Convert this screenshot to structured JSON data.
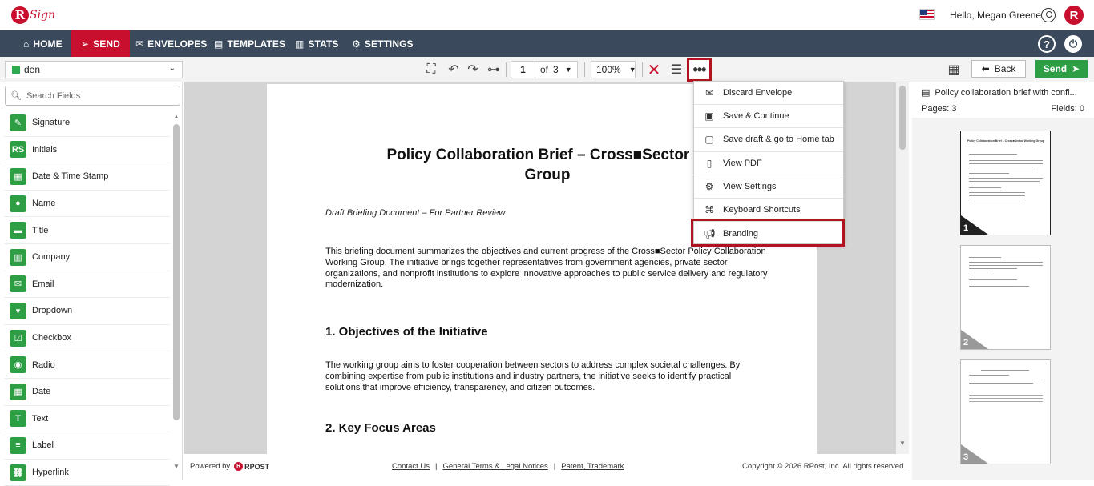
{
  "header": {
    "logo_text": "Sign",
    "greeting": "Hello, Megan Greene",
    "brand_letter": "R"
  },
  "nav": {
    "items": [
      {
        "label": "HOME",
        "icon": "home-icon"
      },
      {
        "label": "SEND",
        "icon": "send-icon"
      },
      {
        "label": "ENVELOPES",
        "icon": "envelope-icon"
      },
      {
        "label": "TEMPLATES",
        "icon": "document-icon"
      },
      {
        "label": "STATS",
        "icon": "bar-chart-icon"
      },
      {
        "label": "SETTINGS",
        "icon": "gear-icon"
      }
    ],
    "active": "SEND",
    "accent": "#c8102e",
    "bg": "#3a4a5c"
  },
  "toolbar": {
    "document": "den",
    "page_current": "1",
    "page_of": "of",
    "page_total": "3",
    "zoom": "100%",
    "back_label": "Back",
    "send_label": "Send"
  },
  "sidebar": {
    "search_placeholder": "Search Fields",
    "fields": [
      {
        "label": "Signature",
        "icon": "pen-icon"
      },
      {
        "label": "Initials",
        "icon": "initials-icon"
      },
      {
        "label": "Date & Time Stamp",
        "icon": "calendar-clock-icon"
      },
      {
        "label": "Name",
        "icon": "person-icon"
      },
      {
        "label": "Title",
        "icon": "briefcase-icon"
      },
      {
        "label": "Company",
        "icon": "building-icon"
      },
      {
        "label": "Email",
        "icon": "mail-icon"
      },
      {
        "label": "Dropdown",
        "icon": "dropdown-icon"
      },
      {
        "label": "Checkbox",
        "icon": "checkbox-icon"
      },
      {
        "label": "Radio",
        "icon": "radio-icon"
      },
      {
        "label": "Date",
        "icon": "calendar-icon"
      },
      {
        "label": "Text",
        "icon": "text-icon"
      },
      {
        "label": "Label",
        "icon": "label-icon"
      },
      {
        "label": "Hyperlink",
        "icon": "link-icon"
      }
    ]
  },
  "document": {
    "title": "Policy Collaboration Brief – Cross■Sector W Group",
    "title_line1": "Policy Collaboration Brief – Cross■Sector W",
    "title_line2": "Group",
    "subtitle": "Draft Briefing Document – For Partner Review",
    "intro": "This briefing document summarizes the objectives and current progress of the Cross■Sector Policy Collaboration Working Group. The initiative brings together representatives from government agencies, private sector organizations, and nonprofit institutions to explore innovative approaches to public service delivery and regulatory modernization.",
    "h1": "1. Objectives of the Initiative",
    "p1": "The working group aims to foster cooperation between sectors to address complex societal challenges. By combining expertise from public institutions and industry partners, the initiative seeks to identify practical solutions that improve efficiency, transparency, and citizen outcomes.",
    "h2": "2. Key Focus Areas"
  },
  "menu": {
    "items": [
      {
        "label": "Discard Envelope",
        "icon": "discard-envelope-icon"
      },
      {
        "label": "Save & Continue",
        "icon": "save-icon"
      },
      {
        "label": "Save draft & go to Home tab",
        "icon": "save-draft-icon"
      },
      {
        "label": "View PDF",
        "icon": "pdf-icon"
      },
      {
        "label": "View Settings",
        "icon": "gear-icon"
      },
      {
        "label": "Keyboard Shortcuts",
        "icon": "command-key-icon"
      },
      {
        "label": "Branding",
        "icon": "megaphone-icon"
      }
    ]
  },
  "right_panel": {
    "doc_title": "Policy collaboration brief with confi...",
    "pages_label": "Pages: 3",
    "fields_label": "Fields: 0",
    "thumbs": [
      "1",
      "2",
      "3"
    ]
  },
  "footer": {
    "powered_by": "Powered by",
    "rpost": "RPOST",
    "links": [
      "Contact Us",
      "General Terms & Legal Notices",
      "Patent, Trademark"
    ],
    "copyright": "Copyright © 2026 RPost, Inc. All rights reserved."
  }
}
